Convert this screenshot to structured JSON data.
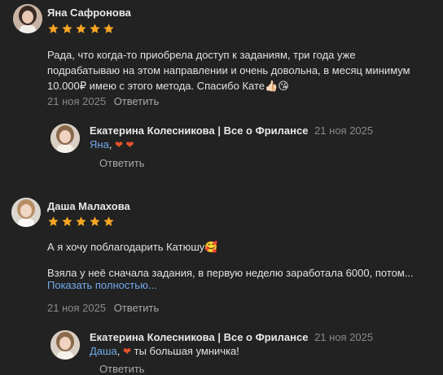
{
  "comments": [
    {
      "author": "Яна Сафронова",
      "rating": 5,
      "text_lines": [
        "Рада, что когда-то приобрела доступ к заданиям, три года уже",
        "подрабатываю на этом направлении и очень довольна, в месяц минимум",
        "10.000₽ имею с этого метода. Спасибо Кате👍🏻😘"
      ],
      "date": "21 ноя 2025",
      "reply_label": "Ответить",
      "reply": {
        "author": "Екатерина Колесникова | Все о Фрилансе",
        "date": "21 ноя 2025",
        "mention": "Яна",
        "after_mention": ", ",
        "hearts": "❤ ❤",
        "tail": "",
        "reply_label": "Ответить"
      }
    },
    {
      "author": "Даша Малахова",
      "rating": 5,
      "text_line1": "А я хочу поблагодарить Катюшу🥰",
      "text_line2": "Взяла у неё сначала задания, в первую неделю заработала 6000, потом...",
      "show_more": "Показать полностью...",
      "date": "21 ноя 2025",
      "reply_label": "Ответить",
      "reply": {
        "author": "Екатерина Колесникова | Все о Фрилансе",
        "date": "21 ноя 2025",
        "mention": "Даша",
        "after_mention": ", ",
        "hearts": "❤",
        "tail": " ты большая умничка!",
        "reply_label": "Ответить"
      }
    }
  ],
  "colors": {
    "background": "#222222",
    "star": "#f5a623",
    "link": "#71aaeb",
    "heart": "#e8522c"
  },
  "icons": {
    "star": "star-icon",
    "heart": "heart-icon"
  }
}
